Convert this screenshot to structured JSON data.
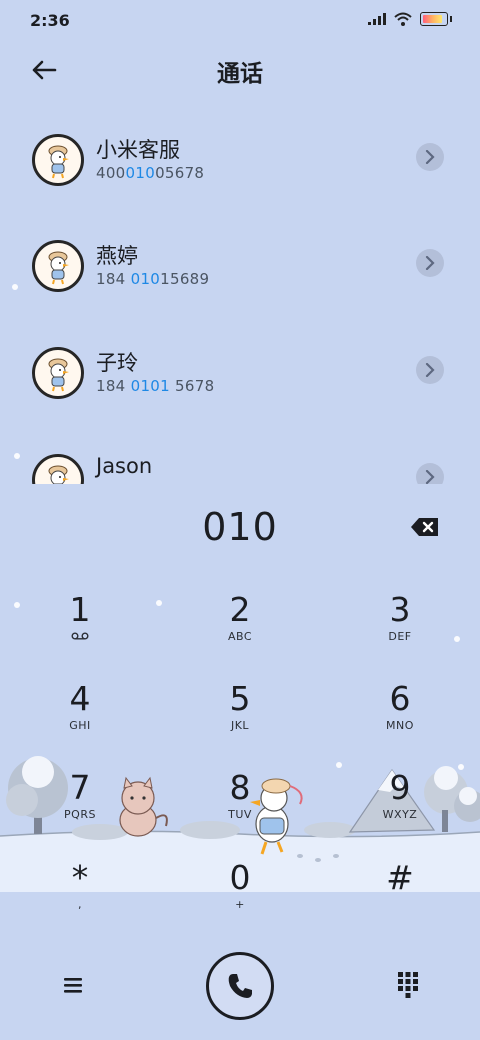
{
  "status": {
    "time": "2:36",
    "battery_level": 0.85
  },
  "header": {
    "title": "通话"
  },
  "contacts": [
    {
      "name": "小米客服",
      "number_pre": "400",
      "number_hl": "010",
      "number_post": "05678"
    },
    {
      "name": "燕婷",
      "number_pre": "184 ",
      "number_hl": "010",
      "number_post": "15689"
    },
    {
      "name": "子玲",
      "number_pre": "184 ",
      "number_hl": "0101",
      "number_post": " 5678"
    },
    {
      "name": "Jason",
      "number_pre": "",
      "number_hl": "",
      "number_post": ""
    }
  ],
  "dialer": {
    "input": "010"
  },
  "keys": [
    {
      "digit": "1",
      "letters": ""
    },
    {
      "digit": "2",
      "letters": "ABC"
    },
    {
      "digit": "3",
      "letters": "DEF"
    },
    {
      "digit": "4",
      "letters": "GHI"
    },
    {
      "digit": "5",
      "letters": "JKL"
    },
    {
      "digit": "6",
      "letters": "MNO"
    },
    {
      "digit": "7",
      "letters": "PQRS"
    },
    {
      "digit": "8",
      "letters": "TUV"
    },
    {
      "digit": "9",
      "letters": "WXYZ"
    },
    {
      "digit": "*",
      "letters": ","
    },
    {
      "digit": "0",
      "letters": "+"
    },
    {
      "digit": "#",
      "letters": ""
    }
  ],
  "icons": {
    "back": "arrow-left-icon",
    "detail": "chevron-right-icon",
    "delete": "backspace-icon",
    "voicemail": "voicemail-icon",
    "menu": "menu-icon",
    "call": "phone-icon",
    "keypad": "dialpad-icon"
  },
  "colors": {
    "background": "#c7d5f1",
    "highlight": "#1e88e5",
    "text": "#1b1d22"
  }
}
